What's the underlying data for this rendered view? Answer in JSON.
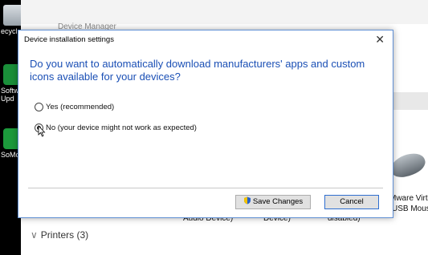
{
  "desktop": {
    "icons": [
      {
        "label": "ecycl",
        "icon": "recycle-bin-icon"
      },
      {
        "label": "Softw",
        "label2": "Upd",
        "icon": "software-update-icon"
      },
      {
        "label": "SoMc",
        "icon": "app-shortcut-icon"
      }
    ]
  },
  "background_window": {
    "title": "Device Manager",
    "labels": [
      "Audio Device)",
      "Device)",
      "disabled)",
      "Mware Virtu",
      "USB Mouse"
    ],
    "printers_label": "Printers (3)"
  },
  "dialog": {
    "title": "Device installation settings",
    "question": "Do you want to automatically download manufacturers' apps and custom icons available for your devices?",
    "options": [
      {
        "label": "Yes (recommended)",
        "selected": false
      },
      {
        "label": "No (your device might not work as expected)",
        "selected": true
      }
    ],
    "save_label": "Save Changes",
    "cancel_label": "Cancel",
    "close_symbol": "✕"
  },
  "colors": {
    "accent": "#1a4fb5",
    "dialog_border": "#5f8fd4"
  }
}
